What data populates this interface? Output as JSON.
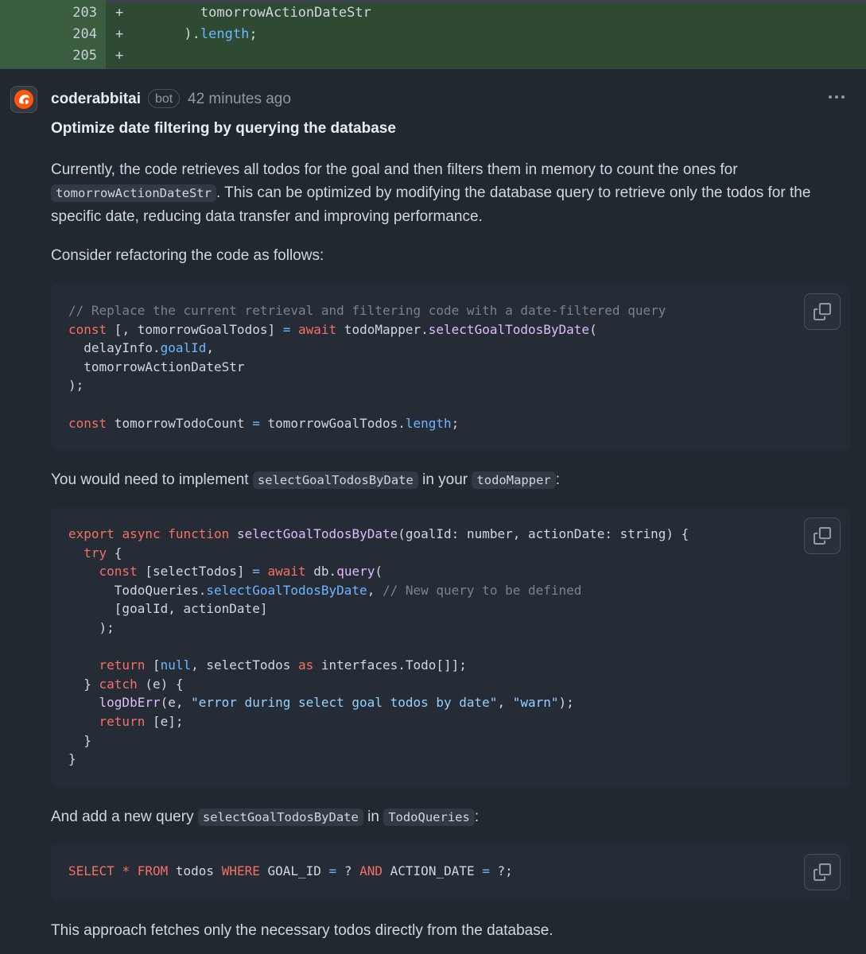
{
  "diff": {
    "rows": [
      {
        "num": "203",
        "sign": "+",
        "code": "        tomorrowActionDateStr"
      },
      {
        "num": "204",
        "sign": "+",
        "code_pre": "      ).",
        "code_prop": "length",
        "code_post": ";"
      },
      {
        "num": "205",
        "sign": "+",
        "code": ""
      }
    ]
  },
  "comment": {
    "author": "coderabbitai",
    "badge": "bot",
    "time": "42 minutes ago",
    "title": "Optimize date filtering by querying the database",
    "p1_a": "Currently, the code retrieves all todos for the goal and then filters them in memory to count the ones for",
    "p1_code": "tomorrowActionDateStr",
    "p1_b": ". This can be optimized by modifying the database query to retrieve only the todos for the specific date, reducing data transfer and improving performance.",
    "p2": "Consider refactoring the code as follows:",
    "p3_a": "You would need to implement ",
    "p3_code1": "selectGoalTodosByDate",
    "p3_b": " in your ",
    "p3_code2": "todoMapper",
    "p3_c": ":",
    "p4_a": "And add a new query ",
    "p4_code1": "selectGoalTodosByDate",
    "p4_b": " in ",
    "p4_code2": "TodoQueries",
    "p4_c": ":",
    "p5": "This approach fetches only the necessary todos directly from the database."
  },
  "code1": {
    "l1": "// Replace the current retrieval and filtering code with a date-filtered query",
    "l2_const": "const",
    "l2_a": " [, tomorrowGoalTodos] ",
    "l2_eq": "=",
    "l2_await": " await",
    "l2_b": " todoMapper.",
    "l2_fn": "selectGoalTodosByDate",
    "l2_c": "(",
    "l3_a": "  delayInfo.",
    "l3_prop": "goalId",
    "l3_b": ",",
    "l4": "  tomorrowActionDateStr",
    "l5": ");",
    "l7_const": "const",
    "l7_a": " tomorrowTodoCount ",
    "l7_eq": "=",
    "l7_b": " tomorrowGoalTodos.",
    "l7_prop": "length",
    "l7_c": ";"
  },
  "code2": {
    "export": "export",
    "async": "async",
    "function": "function",
    "fname": "selectGoalTodosByDate",
    "params": "(goalId: number, actionDate: string) {",
    "try": "try",
    "brace_open": " {",
    "const": "const",
    "sel": " [selectTodos] ",
    "eq": "=",
    "await": "await",
    "db": " db.",
    "query": "query",
    "paren": "(",
    "tq": "      TodoQueries.",
    "tq_fn": "selectGoalTodosByDate",
    "tq_comma": ", ",
    "tq_comment": "// New query to be defined",
    "args": "      [goalId, actionDate]",
    "close_call": "    );",
    "return": "return",
    "ret_a": " [",
    "null": "null",
    "ret_b": ", selectTodos ",
    "as": "as",
    "ret_c": " interfaces.Todo[]];",
    "close_try": "  } ",
    "catch": "catch",
    "catch_b": " (e) {",
    "log": "logDbErr",
    "log_a": "(e, ",
    "log_s1": "\"error during select goal todos by date\"",
    "log_b": ", ",
    "log_s2": "\"warn\"",
    "log_c": ");",
    "ret2_b": " [e];",
    "close_catch": "  }",
    "close_fn": "}"
  },
  "code3": {
    "select": "SELECT",
    "star": "*",
    "from": "FROM",
    "table": " todos ",
    "where": "WHERE",
    "col1": " GOAL_ID ",
    "eq": "=",
    "q1": " ? ",
    "and": "AND",
    "col2": " ACTION_DATE ",
    "q2": " ?;"
  },
  "icons": {
    "avatar": "coderabbit-logo-icon",
    "kebab": "kebab-horizontal-icon",
    "copy": "copy-icon"
  },
  "colors": {
    "background": "#212830",
    "diff_added": "#2e4a33",
    "keyword": "#f47067",
    "function": "#dcbdfb",
    "property": "#6cb6ff",
    "comment": "#768390",
    "string": "#96d0ff"
  }
}
